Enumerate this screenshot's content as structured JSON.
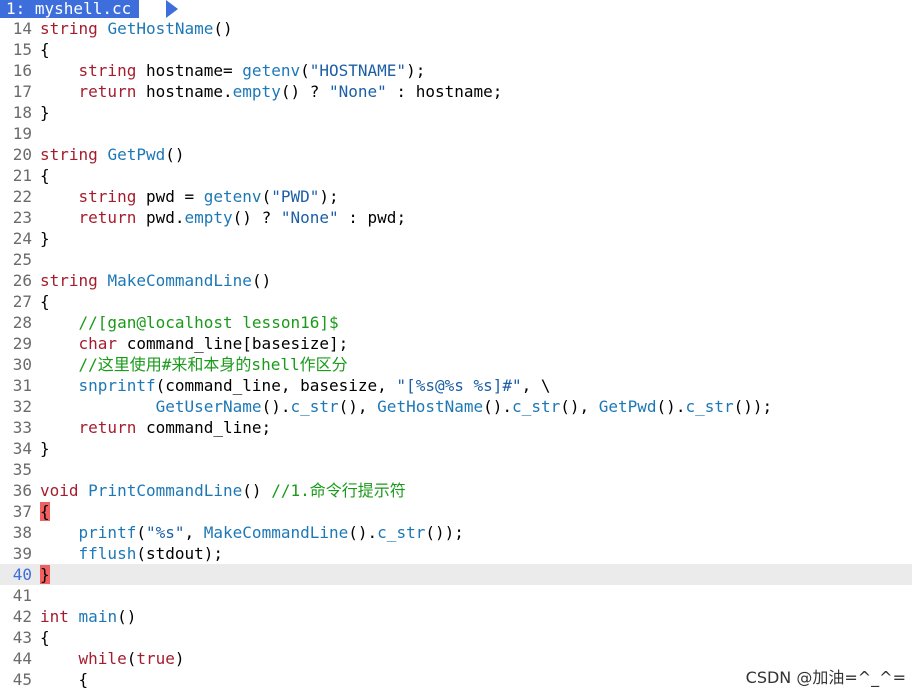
{
  "tab": {
    "label": "1: myshell.cc"
  },
  "watermark": "CSDN @加油=^_^=",
  "cursor_line": "40",
  "colors": {
    "type": "#a51d2d",
    "func": "#1d78b6",
    "str": "#1d5fa6",
    "comment": "#1a9a1a",
    "match": "#f06060",
    "tab_bg": "#3d6edb"
  },
  "lines": [
    {
      "n": "14",
      "t": [
        [
          "type",
          "string"
        ],
        [
          "plain",
          " "
        ],
        [
          "func",
          "GetHostName"
        ],
        [
          "plain",
          "()"
        ]
      ]
    },
    {
      "n": "15",
      "t": [
        [
          "plain",
          "{"
        ]
      ]
    },
    {
      "n": "16",
      "t": [
        [
          "plain",
          "    "
        ],
        [
          "type",
          "string"
        ],
        [
          "plain",
          " hostname= "
        ],
        [
          "func",
          "getenv"
        ],
        [
          "plain",
          "("
        ],
        [
          "str",
          "\"HOSTNAME\""
        ],
        [
          "plain",
          ");"
        ]
      ]
    },
    {
      "n": "17",
      "t": [
        [
          "plain",
          "    "
        ],
        [
          "type",
          "return"
        ],
        [
          "plain",
          " hostname."
        ],
        [
          "func",
          "empty"
        ],
        [
          "plain",
          "() ? "
        ],
        [
          "str",
          "\"None\""
        ],
        [
          "plain",
          " : hostname;"
        ]
      ]
    },
    {
      "n": "18",
      "t": [
        [
          "plain",
          "}"
        ]
      ]
    },
    {
      "n": "19",
      "t": []
    },
    {
      "n": "20",
      "t": [
        [
          "type",
          "string"
        ],
        [
          "plain",
          " "
        ],
        [
          "func",
          "GetPwd"
        ],
        [
          "plain",
          "()"
        ]
      ]
    },
    {
      "n": "21",
      "t": [
        [
          "plain",
          "{"
        ]
      ]
    },
    {
      "n": "22",
      "t": [
        [
          "plain",
          "    "
        ],
        [
          "type",
          "string"
        ],
        [
          "plain",
          " pwd = "
        ],
        [
          "func",
          "getenv"
        ],
        [
          "plain",
          "("
        ],
        [
          "str",
          "\"PWD\""
        ],
        [
          "plain",
          ");"
        ]
      ]
    },
    {
      "n": "23",
      "t": [
        [
          "plain",
          "    "
        ],
        [
          "type",
          "return"
        ],
        [
          "plain",
          " pwd."
        ],
        [
          "func",
          "empty"
        ],
        [
          "plain",
          "() ? "
        ],
        [
          "str",
          "\"None\""
        ],
        [
          "plain",
          " : pwd;"
        ]
      ]
    },
    {
      "n": "24",
      "t": [
        [
          "plain",
          "}"
        ]
      ]
    },
    {
      "n": "25",
      "t": []
    },
    {
      "n": "26",
      "t": [
        [
          "type",
          "string"
        ],
        [
          "plain",
          " "
        ],
        [
          "func",
          "MakeCommandLine"
        ],
        [
          "plain",
          "()"
        ]
      ]
    },
    {
      "n": "27",
      "t": [
        [
          "plain",
          "{"
        ]
      ]
    },
    {
      "n": "28",
      "t": [
        [
          "plain",
          "    "
        ],
        [
          "comment",
          "//[gan@localhost lesson16]$"
        ]
      ]
    },
    {
      "n": "29",
      "t": [
        [
          "plain",
          "    "
        ],
        [
          "type",
          "char"
        ],
        [
          "plain",
          " command_line[basesize];"
        ]
      ]
    },
    {
      "n": "30",
      "t": [
        [
          "plain",
          "    "
        ],
        [
          "comment",
          "//这里使用#来和本身的shell作区分"
        ]
      ]
    },
    {
      "n": "31",
      "t": [
        [
          "plain",
          "    "
        ],
        [
          "func",
          "snprintf"
        ],
        [
          "plain",
          "(command_line, basesize, "
        ],
        [
          "str",
          "\"[%s@%s %s]#\""
        ],
        [
          "plain",
          ", \\"
        ]
      ]
    },
    {
      "n": "32",
      "t": [
        [
          "plain",
          "            "
        ],
        [
          "func",
          "GetUserName"
        ],
        [
          "plain",
          "()."
        ],
        [
          "func",
          "c_str"
        ],
        [
          "plain",
          "(), "
        ],
        [
          "func",
          "GetHostName"
        ],
        [
          "plain",
          "()."
        ],
        [
          "func",
          "c_str"
        ],
        [
          "plain",
          "(), "
        ],
        [
          "func",
          "GetPwd"
        ],
        [
          "plain",
          "()."
        ],
        [
          "func",
          "c_str"
        ],
        [
          "plain",
          "());"
        ]
      ]
    },
    {
      "n": "33",
      "t": [
        [
          "plain",
          "    "
        ],
        [
          "type",
          "return"
        ],
        [
          "plain",
          " command_line;"
        ]
      ]
    },
    {
      "n": "34",
      "t": [
        [
          "plain",
          "}"
        ]
      ]
    },
    {
      "n": "35",
      "t": []
    },
    {
      "n": "36",
      "t": [
        [
          "type",
          "void"
        ],
        [
          "plain",
          " "
        ],
        [
          "func",
          "PrintCommandLine"
        ],
        [
          "plain",
          "() "
        ],
        [
          "comment",
          "//1.命令行提示符"
        ]
      ]
    },
    {
      "n": "37",
      "t": [
        [
          "match",
          "{"
        ]
      ]
    },
    {
      "n": "38",
      "t": [
        [
          "plain",
          "    "
        ],
        [
          "func",
          "printf"
        ],
        [
          "plain",
          "("
        ],
        [
          "str",
          "\"%s\""
        ],
        [
          "plain",
          ", "
        ],
        [
          "func",
          "MakeCommandLine"
        ],
        [
          "plain",
          "()."
        ],
        [
          "func",
          "c_str"
        ],
        [
          "plain",
          "());"
        ]
      ]
    },
    {
      "n": "39",
      "t": [
        [
          "plain",
          "    "
        ],
        [
          "func",
          "fflush"
        ],
        [
          "plain",
          "(stdout);"
        ]
      ]
    },
    {
      "n": "40",
      "t": [
        [
          "match",
          "}"
        ]
      ]
    },
    {
      "n": "41",
      "t": []
    },
    {
      "n": "42",
      "t": [
        [
          "type",
          "int"
        ],
        [
          "plain",
          " "
        ],
        [
          "func",
          "main"
        ],
        [
          "plain",
          "()"
        ]
      ]
    },
    {
      "n": "43",
      "t": [
        [
          "plain",
          "{"
        ]
      ]
    },
    {
      "n": "44",
      "t": [
        [
          "plain",
          "    "
        ],
        [
          "type",
          "while"
        ],
        [
          "plain",
          "("
        ],
        [
          "type",
          "true"
        ],
        [
          "plain",
          ")"
        ]
      ]
    },
    {
      "n": "45",
      "t": [
        [
          "plain",
          "    {"
        ]
      ]
    }
  ]
}
